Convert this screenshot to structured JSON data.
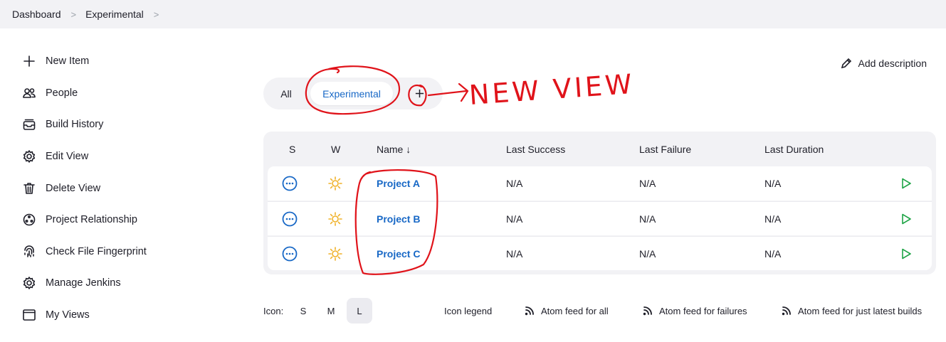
{
  "breadcrumb": [
    "Dashboard",
    "Experimental"
  ],
  "sidebar": {
    "items": [
      {
        "label": "New Item",
        "icon": "plus-icon"
      },
      {
        "label": "People",
        "icon": "people-icon"
      },
      {
        "label": "Build History",
        "icon": "inbox-icon"
      },
      {
        "label": "Edit View",
        "icon": "gear-icon"
      },
      {
        "label": "Delete View",
        "icon": "trash-icon"
      },
      {
        "label": "Project Relationship",
        "icon": "relationship-icon"
      },
      {
        "label": "Check File Fingerprint",
        "icon": "fingerprint-icon"
      },
      {
        "label": "Manage Jenkins",
        "icon": "gear-icon"
      },
      {
        "label": "My Views",
        "icon": "window-icon"
      }
    ]
  },
  "header": {
    "add_description": "Add description"
  },
  "tabs": [
    {
      "label": "All",
      "active": false
    },
    {
      "label": "Experimental",
      "active": true
    }
  ],
  "annotation": {
    "text": "NEW VIEW",
    "color": "#e0131a"
  },
  "table": {
    "columns": [
      "S",
      "W",
      "Name ↓",
      "Last Success",
      "Last Failure",
      "Last Duration"
    ],
    "rows": [
      {
        "name": "Project A",
        "last_success": "N/A",
        "last_failure": "N/A",
        "last_duration": "N/A"
      },
      {
        "name": "Project B",
        "last_success": "N/A",
        "last_failure": "N/A",
        "last_duration": "N/A"
      },
      {
        "name": "Project C",
        "last_success": "N/A",
        "last_failure": "N/A",
        "last_duration": "N/A"
      }
    ]
  },
  "footer": {
    "icon_label": "Icon:",
    "sizes": [
      "S",
      "M",
      "L"
    ],
    "active_size": "L",
    "icon_legend": "Icon legend",
    "feeds": [
      "Atom feed for all",
      "Atom feed for failures",
      "Atom feed for just latest builds"
    ]
  },
  "colors": {
    "link": "#1868c6",
    "accent_sun": "#f0b22a",
    "play": "#1ea446",
    "status_blue": "#1868c6"
  }
}
